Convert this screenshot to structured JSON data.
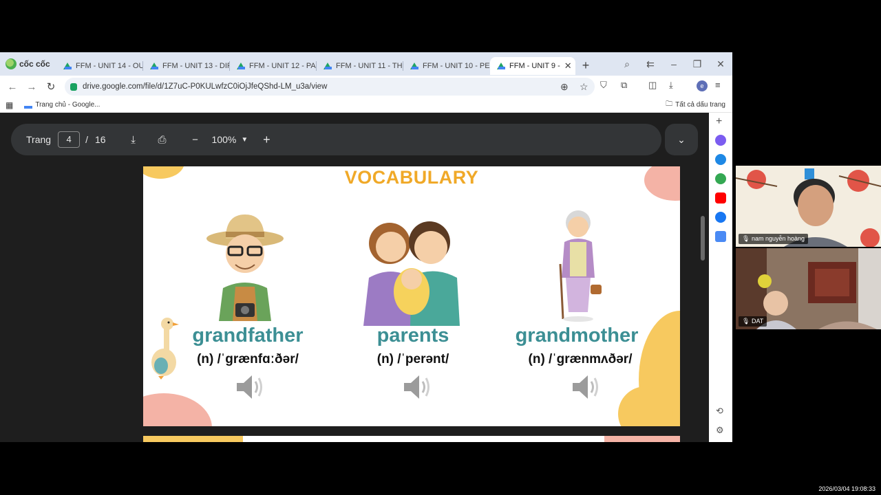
{
  "browser": {
    "brand": "cốc cốc",
    "tabs": [
      {
        "label": "FFM - UNIT 14 - OUR",
        "active": false
      },
      {
        "label": "FFM - UNIT 13 - DIFF",
        "active": false
      },
      {
        "label": "FFM - UNIT 12 - PAR",
        "active": false
      },
      {
        "label": "FFM - UNIT 11 - THE",
        "active": false
      },
      {
        "label": "FFM - UNIT 10 - PEO",
        "active": false
      },
      {
        "label": "FFM - UNIT 9 -",
        "active": true
      }
    ],
    "url": "drive.google.com/file/d/1Z7uC-P0KULwfzC0iOjJfeQShd-LM_u3a/view",
    "bookmark": "Trang chủ - Google...",
    "all_bookmarks": "Tất cả dấu trang"
  },
  "viewer": {
    "page_label": "Trang",
    "page_current": "4",
    "page_separator": "/",
    "page_total": "16",
    "zoom": "100%"
  },
  "slide": {
    "title": "VOCABULARY",
    "items": [
      {
        "word": "grandfather",
        "ipa": "(n) /ˈɡrænfɑːðər/"
      },
      {
        "word": "parents",
        "ipa": "(n) /ˈperənt/"
      },
      {
        "word": "grandmother",
        "ipa": "(n) /ˈɡrænmʌðər/"
      }
    ]
  },
  "video": {
    "participant_1": "nam nguyễn hoàng",
    "participant_2": "DAT",
    "timestamp": "2026/03/04 19:08:33"
  },
  "colors": {
    "title": "#f0a928",
    "word": "#3c8f94",
    "blob_pink": "#f4b3a6",
    "blob_yellow": "#f7c95f"
  }
}
